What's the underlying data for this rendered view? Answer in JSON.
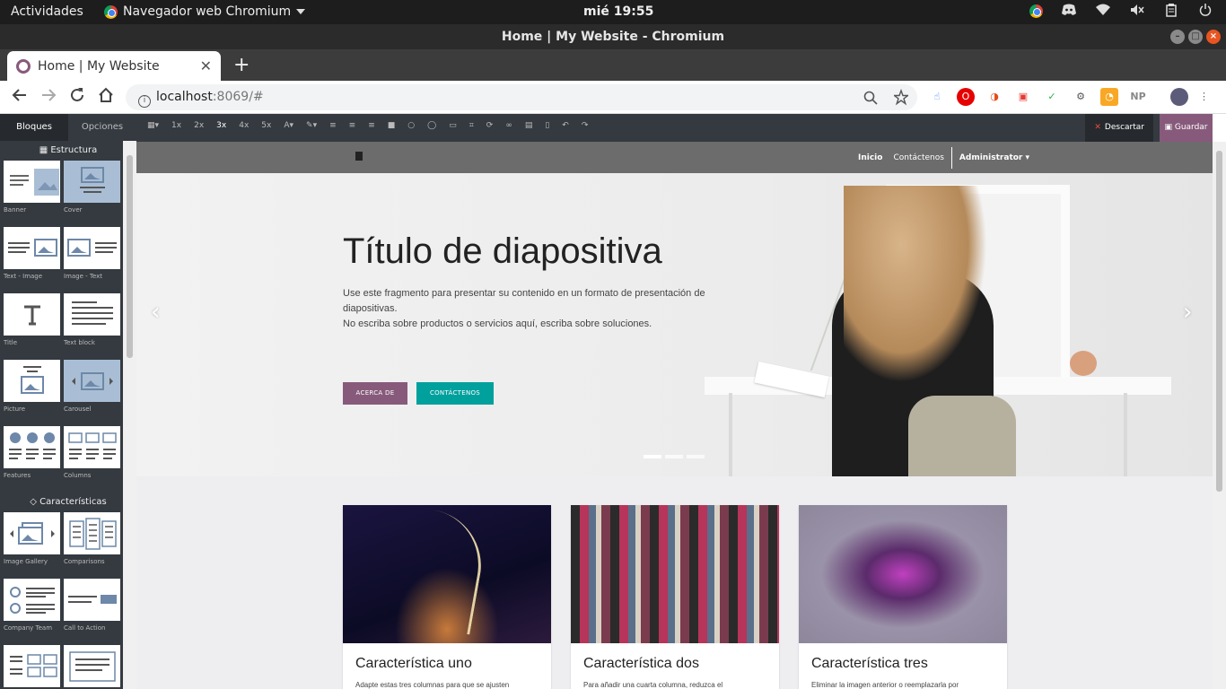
{
  "os_bar": {
    "activities": "Actividades",
    "app_menu": "Navegador web Chromium",
    "clock": "mié 19:55",
    "icons": [
      "chrome-badge-icon",
      "discord-icon",
      "wifi-icon",
      "volume-muted-icon",
      "clipboard-icon",
      "power-icon"
    ]
  },
  "window": {
    "title": "Home | My Website - Chromium"
  },
  "browser": {
    "tab_title": "Home | My Website",
    "url_host": "localhost",
    "url_path": ":8069/#",
    "extensions": [
      "touch-icon",
      "opera-icon",
      "pocket-icon",
      "tablet-icon",
      "feedly-icon",
      "settings-ext-icon",
      "rss-icon",
      "np-icon",
      "profile-avatar"
    ],
    "ext_np": "NP"
  },
  "editor": {
    "panel_tabs": [
      "Bloques",
      "Opciones"
    ],
    "structure_title": "Estructura",
    "features_title": "Características",
    "structure_snippets": [
      "Banner",
      "Cover",
      "Text - Image",
      "Image - Text",
      "Title",
      "Text block",
      "Picture",
      "Carousel",
      "Features",
      "Columns"
    ],
    "feature_snippets": [
      "Image Gallery",
      "Comparisons",
      "Company Team",
      "Call to Action"
    ],
    "toolbar_sizes": [
      "1x",
      "2x",
      "3x",
      "4x",
      "5x"
    ],
    "discard_label": "Descartar",
    "save_label": "Guardar"
  },
  "site": {
    "nav": {
      "home": "Inicio",
      "contact": "Contáctenos",
      "admin": "Administrator"
    },
    "hero": {
      "title": "Título de diapositiva",
      "text_line1": "Use este fragmento para presentar su contenido en un formato de presentación de diapositivas.",
      "text_line2": "No escriba sobre productos o servicios aquí, escriba sobre soluciones.",
      "button_about": "ACERCA DE",
      "button_contact": "CONTÁCTENOS"
    },
    "cards": [
      {
        "title": "Característica uno",
        "text": "Adapte estas tres columnas para que se ajusten"
      },
      {
        "title": "Característica dos",
        "text": "Para añadir una cuarta columna, reduzca el"
      },
      {
        "title": "Característica tres",
        "text": "Eliminar la imagen anterior o reemplazarla por"
      }
    ]
  },
  "colors": {
    "odoo_purple": "#875a7b",
    "odoo_teal": "#00a09d",
    "editor_dark": "#343a40"
  }
}
